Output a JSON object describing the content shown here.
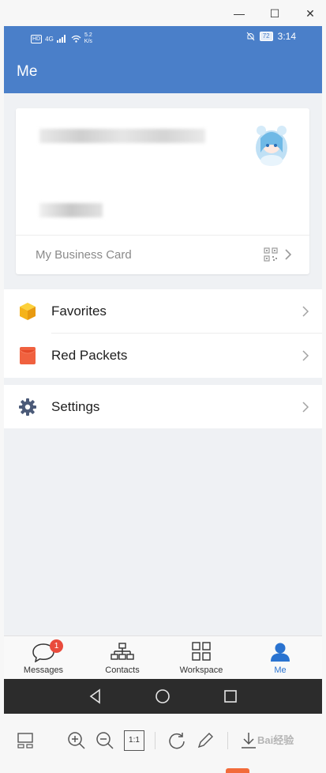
{
  "window": {
    "controls": {
      "minimize": "—",
      "maximize": "☐",
      "close": "✕"
    }
  },
  "statusbar": {
    "hd": "HD",
    "network": "4G",
    "speed_value": "5.2",
    "speed_unit": "K/s",
    "battery": "72",
    "time": "3:14"
  },
  "appbar": {
    "title": "Me"
  },
  "profile": {
    "business_card_label": "My Business Card",
    "icons": {
      "qr": "qr-code-icon",
      "chevron": "chevron-right-icon",
      "avatar": "avatar"
    }
  },
  "menu": {
    "items": [
      {
        "label": "Favorites",
        "icon": "favorites-cube-icon",
        "color": "#f5b31b"
      },
      {
        "label": "Red Packets",
        "icon": "red-packet-icon",
        "color": "#f0613f"
      },
      {
        "label": "Settings",
        "icon": "gear-icon",
        "color": "#4b5a78"
      }
    ]
  },
  "tabs": [
    {
      "label": "Messages",
      "icon": "chat-bubble-icon",
      "badge": "1"
    },
    {
      "label": "Contacts",
      "icon": "org-chart-icon"
    },
    {
      "label": "Workspace",
      "icon": "grid-icon"
    },
    {
      "label": "Me",
      "icon": "person-icon",
      "active": true
    }
  ],
  "colors": {
    "accent": "#4a7fc9",
    "active_tab": "#2a73d0",
    "badge": "#e94b3c"
  },
  "viewer_toolbar": {
    "buttons": [
      "thumbnail-icon",
      "zoom-in-icon",
      "zoom-out-icon",
      "actual-size-icon",
      "rotate-icon",
      "edit-icon",
      "download-icon"
    ],
    "actual_size_label": "1:1",
    "watermark": "Bai经验"
  }
}
